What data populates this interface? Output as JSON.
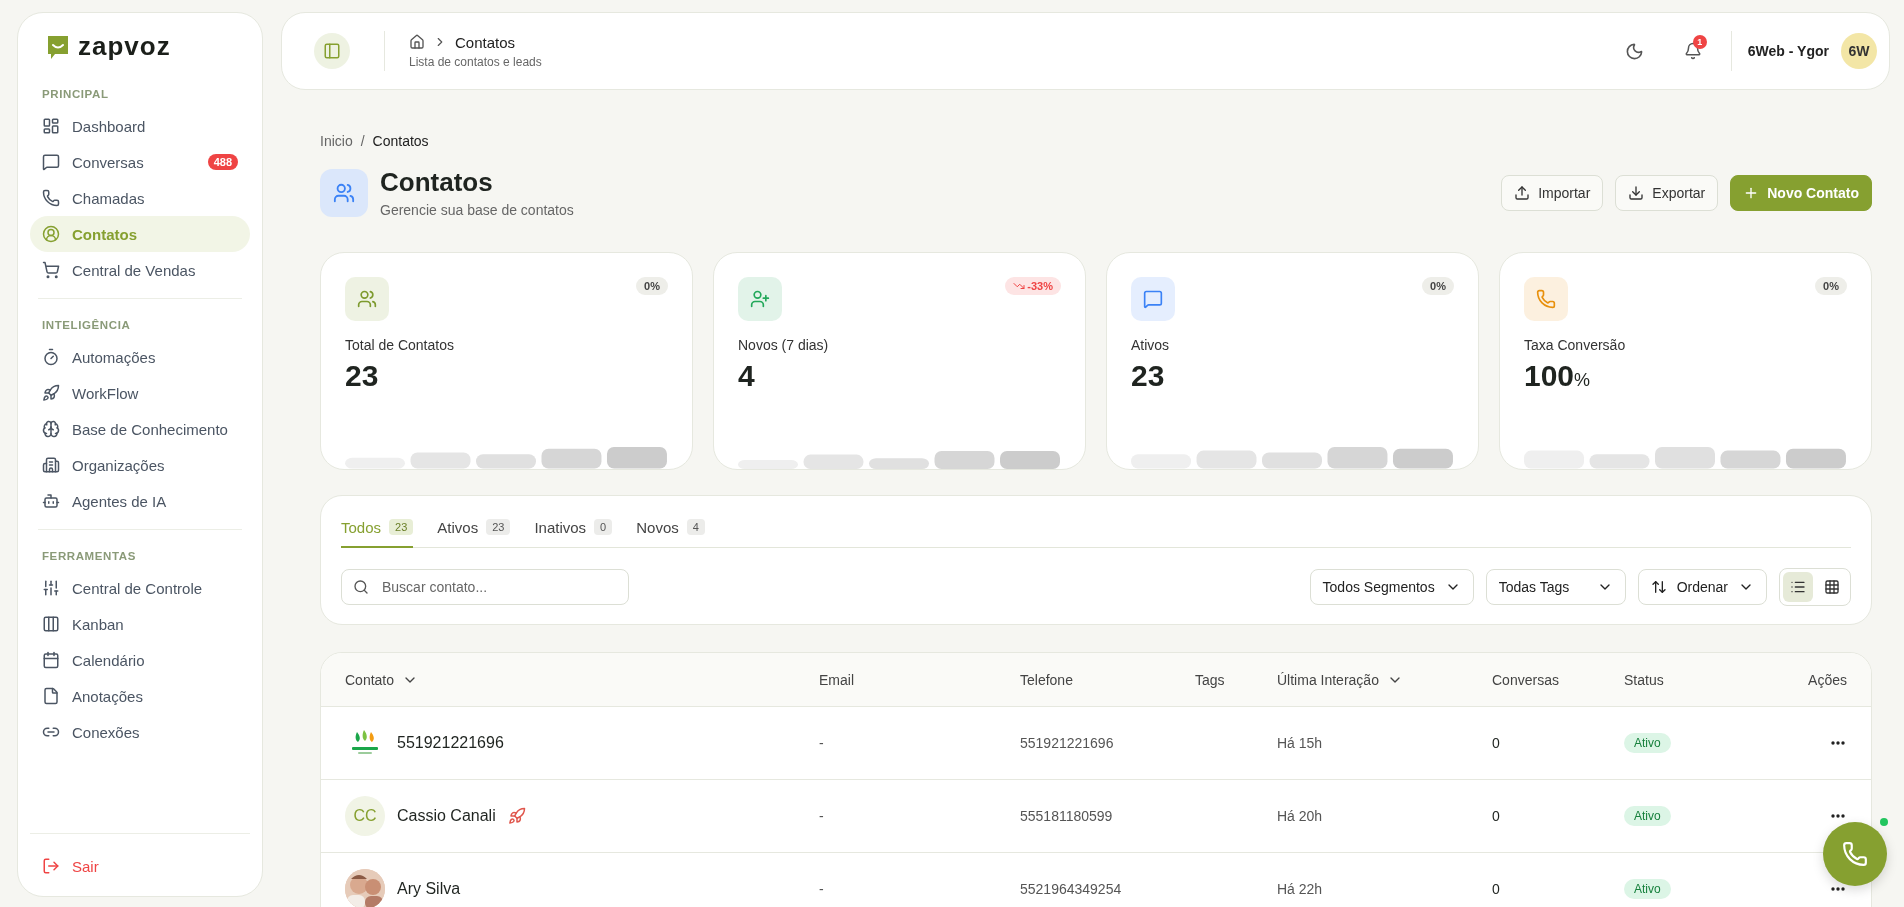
{
  "brand": {
    "name": "zapvoz"
  },
  "sidebar": {
    "sections": [
      {
        "title": "PRINCIPAL",
        "items": [
          {
            "label": "Dashboard",
            "selected": false
          },
          {
            "label": "Conversas",
            "selected": false,
            "badge": "488"
          },
          {
            "label": "Chamadas",
            "selected": false
          },
          {
            "label": "Contatos",
            "selected": true
          },
          {
            "label": "Central de Vendas",
            "selected": false
          }
        ]
      },
      {
        "title": "INTELIGÊNCIA",
        "items": [
          {
            "label": "Automações",
            "selected": false
          },
          {
            "label": "WorkFlow",
            "selected": false
          },
          {
            "label": "Base de Conhecimento",
            "selected": false
          },
          {
            "label": "Organizações",
            "selected": false
          },
          {
            "label": "Agentes de IA",
            "selected": false
          }
        ]
      },
      {
        "title": "FERRAMENTAS",
        "items": [
          {
            "label": "Central de Controle",
            "selected": false
          },
          {
            "label": "Kanban",
            "selected": false
          },
          {
            "label": "Calendário",
            "selected": false
          },
          {
            "label": "Anotações",
            "selected": false
          },
          {
            "label": "Conexões",
            "selected": false
          }
        ]
      }
    ],
    "logout": "Sair"
  },
  "header": {
    "title": "Contatos",
    "subtitle": "Lista de contatos e leads",
    "notifications": "1",
    "user": "6Web - Ygor",
    "avatar": "6W"
  },
  "breadcrumb": {
    "items": [
      "Inicio",
      "Contatos"
    ],
    "separator": "/"
  },
  "page": {
    "title": "Contatos",
    "subtitle": "Gerencie sua base de contatos",
    "actions": [
      {
        "label": "Importar",
        "kind": "upload"
      },
      {
        "label": "Exportar",
        "kind": "download"
      },
      {
        "label": "Novo Contato",
        "kind": "primary"
      }
    ]
  },
  "stats": [
    {
      "label": "Total de Contatos",
      "value": "23",
      "change": "0%",
      "kind": "neutral",
      "color": "#7d9a2e"
    },
    {
      "label": "Novos (7 dias)",
      "value": "4",
      "change": "-33%",
      "kind": "down",
      "color": "#22a85a"
    },
    {
      "label": "Ativos",
      "value": "23",
      "change": "0%",
      "kind": "neutral",
      "color": "#3b82f6"
    },
    {
      "label": "Taxa Conversão",
      "value": "100",
      "unit": "%",
      "change": "0%",
      "kind": "neutral",
      "color": "#e8900c"
    }
  ],
  "tabs": [
    {
      "label": "Todos",
      "count": "23",
      "selected": true
    },
    {
      "label": "Ativos",
      "count": "23",
      "selected": false
    },
    {
      "label": "Inativos",
      "count": "0",
      "selected": false
    },
    {
      "label": "Novos",
      "count": "4",
      "selected": false
    }
  ],
  "search": {
    "placeholder": "Buscar contato..."
  },
  "filters": [
    {
      "label": "Todos Segmentos",
      "kind": "select"
    },
    {
      "label": "Todas Tags",
      "kind": "select"
    },
    {
      "label": "Ordenar",
      "kind": "sort"
    }
  ],
  "view_modes": [
    {
      "kind": "list",
      "selected": true
    },
    {
      "kind": "grid",
      "selected": false
    }
  ],
  "table": {
    "columns": [
      {
        "label": "Contato",
        "sortable": true
      },
      {
        "label": "Email",
        "sortable": false
      },
      {
        "label": "Telefone",
        "sortable": false
      },
      {
        "label": "Tags",
        "sortable": false
      },
      {
        "label": "Última Interação",
        "sortable": true
      },
      {
        "label": "Conversas",
        "sortable": false
      },
      {
        "label": "Status",
        "sortable": false
      },
      {
        "label": "Ações",
        "sortable": false
      }
    ],
    "rows": [
      {
        "avatar": {
          "kind": "logo"
        },
        "name": "551921221696",
        "email": "-",
        "phone": "551921221696",
        "last": "Há 15h",
        "conversations": "0",
        "status": "Ativo"
      },
      {
        "avatar": {
          "kind": "initials",
          "text": "CC"
        },
        "name": "Cassio Canali",
        "emoji": {
          "kind": "rocket"
        },
        "email": "-",
        "phone": "555181180599",
        "last": "Há 20h",
        "conversations": "0",
        "status": "Ativo"
      },
      {
        "name": "Ary Silva",
        "email": "-",
        "phone": "5521964349254",
        "last": "Há 22h",
        "conversations": "0",
        "status": "Ativo"
      }
    ]
  }
}
